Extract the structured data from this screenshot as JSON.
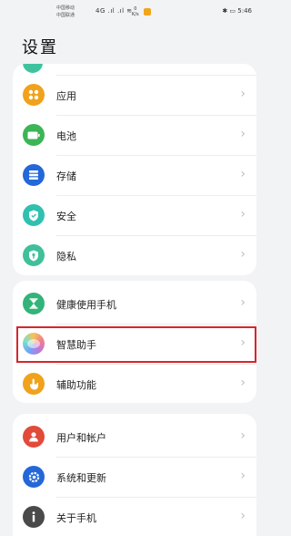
{
  "status_bar": {
    "carrier_1": "中国移动",
    "carrier_2": "中国联通",
    "signal": "4G .ıl  .ıl  ≋",
    "speed_value": "0",
    "speed_unit": "K/s",
    "right": "✱ ▭ 5:46"
  },
  "page_title": "设置",
  "group1": [
    {
      "label": "应用",
      "icon": "apps-icon",
      "color": "#f0a21c"
    },
    {
      "label": "电池",
      "icon": "battery-icon",
      "color": "#3bb555"
    },
    {
      "label": "存储",
      "icon": "storage-icon",
      "color": "#2467d8"
    },
    {
      "label": "安全",
      "icon": "security-icon",
      "color": "#2fc0b0"
    },
    {
      "label": "隐私",
      "icon": "privacy-icon",
      "color": "#3fc09a"
    }
  ],
  "group2": [
    {
      "label": "健康使用手机",
      "icon": "hourglass-icon",
      "color": "#33b37a"
    },
    {
      "label": "智慧助手",
      "icon": "smart-assistant-icon",
      "color": "#c07ad8"
    },
    {
      "label": "辅助功能",
      "icon": "accessibility-icon",
      "color": "#f0a21c"
    }
  ],
  "group3": [
    {
      "label": "用户和帐户",
      "icon": "user-icon",
      "color": "#e24a3a"
    },
    {
      "label": "系统和更新",
      "icon": "system-update-icon",
      "color": "#2467d8"
    },
    {
      "label": "关于手机",
      "icon": "info-icon",
      "color": "#4a4a4a"
    }
  ],
  "chevron": "›",
  "highlight_color": "#d6262c"
}
